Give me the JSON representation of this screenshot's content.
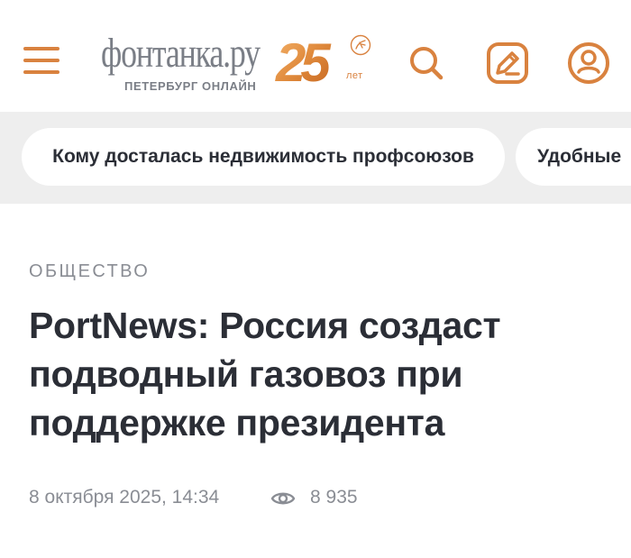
{
  "header": {
    "logo": {
      "wordmark": "фонтанка.ру",
      "subtitle": "ПЕТЕРБУРГ ОНЛАЙН",
      "anniversary_number": "25",
      "anniversary_suffix": "лет"
    },
    "icons": [
      "menu-icon",
      "search-icon",
      "edit-icon",
      "profile-icon"
    ]
  },
  "tags": [
    {
      "label": "Кому досталась недвижимость профсоюзов"
    },
    {
      "label": "Удобные"
    }
  ],
  "article": {
    "rubric": "ОБЩЕСТВО",
    "title": "PortNews: Россия создаст подводный газовоз при поддержке президента",
    "date": "8 октября 2025, 14:34",
    "views": "8 935"
  },
  "colors": {
    "accent": "#d9823f",
    "text": "#2b2e36",
    "muted": "#8a8d94",
    "band": "#eeeeee"
  }
}
